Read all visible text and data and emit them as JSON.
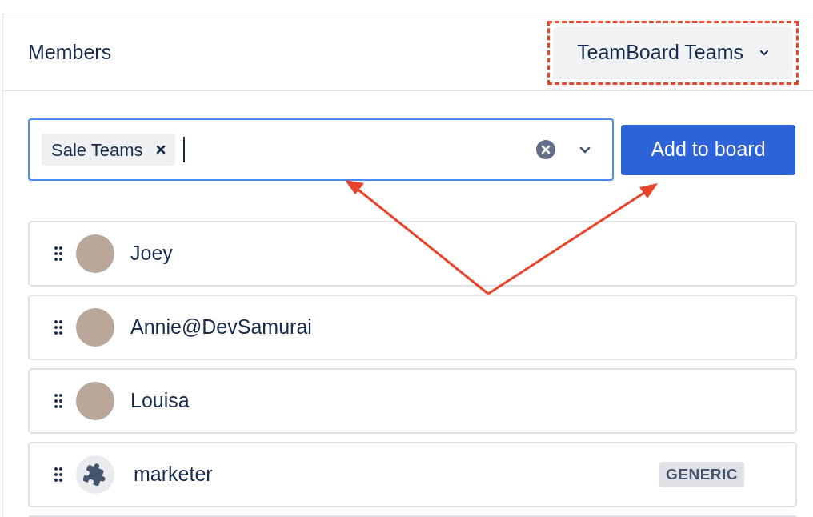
{
  "header": {
    "title": "Members",
    "team_dropdown": {
      "label": "TeamBoard Teams",
      "highlighted": true
    }
  },
  "picker": {
    "tags": [
      {
        "label": "Sale Teams"
      }
    ],
    "focused": true
  },
  "add_button": {
    "label": "Add to board"
  },
  "members": [
    {
      "name": "Joey",
      "kind": "photo"
    },
    {
      "name": "Annie@DevSamurai",
      "kind": "photo"
    },
    {
      "name": "Louisa",
      "kind": "photo"
    },
    {
      "name": "marketer",
      "kind": "app",
      "badge": "GENERIC"
    }
  ]
}
